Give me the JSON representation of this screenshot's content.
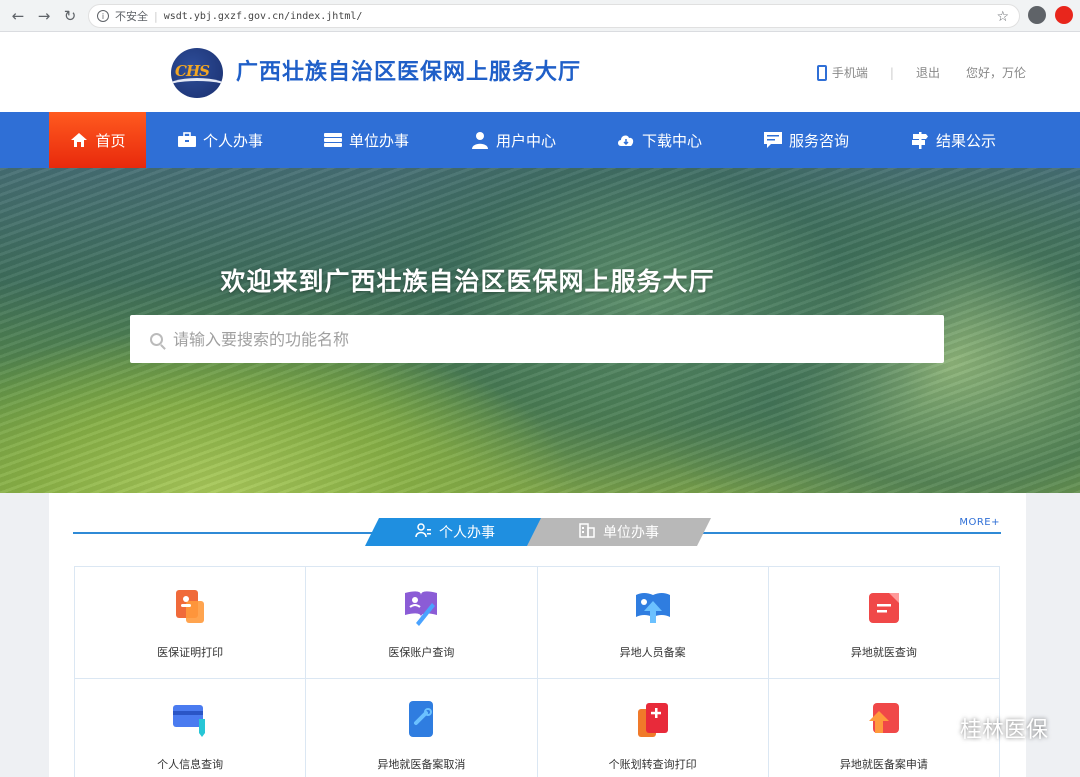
{
  "browser": {
    "security_label": "不安全",
    "url": "wsdt.ybj.gxzf.gov.cn/index.jhtml/"
  },
  "header": {
    "logo_text": "CHS",
    "title": "广西壮族自治区医保网上服务大厅",
    "mobile_label": "手机端",
    "divider": "|",
    "logout_label": "退出",
    "greeting": "您好，万伦"
  },
  "nav": {
    "items": [
      {
        "label": "首页",
        "icon": "home-icon"
      },
      {
        "label": "个人办事",
        "icon": "briefcase-icon"
      },
      {
        "label": "单位办事",
        "icon": "server-icon"
      },
      {
        "label": "用户中心",
        "icon": "user-icon"
      },
      {
        "label": "下载中心",
        "icon": "cloud-download-icon"
      },
      {
        "label": "服务咨询",
        "icon": "chat-icon"
      },
      {
        "label": "结果公示",
        "icon": "signpost-icon"
      }
    ],
    "active_index": 0
  },
  "banner": {
    "title": "欢迎来到广西壮族自治区医保网上服务大厅",
    "search_placeholder": "请输入要搜索的功能名称"
  },
  "services": {
    "tabs": [
      {
        "label": "个人办事",
        "active": true
      },
      {
        "label": "单位办事",
        "active": false
      }
    ],
    "more_label": "MORE+",
    "items": [
      {
        "label": "医保证明打印",
        "icon": "certificate-print-icon"
      },
      {
        "label": "医保账户查询",
        "icon": "account-book-icon"
      },
      {
        "label": "异地人员备案",
        "icon": "relocation-register-icon"
      },
      {
        "label": "异地就医查询",
        "icon": "medical-query-icon"
      },
      {
        "label": "个人信息查询",
        "icon": "card-info-icon"
      },
      {
        "label": "异地就医备案取消",
        "icon": "cancel-register-icon"
      },
      {
        "label": "个账划转查询打印",
        "icon": "transfer-print-icon"
      },
      {
        "label": "异地就医备案申请",
        "icon": "apply-register-icon"
      }
    ]
  },
  "watermark": {
    "text": "桂林医保"
  },
  "colors": {
    "primary": "#2f6fd6",
    "active_nav": "#e8290c",
    "title_blue": "#1f5fc8",
    "tab_active": "#1f8fe0",
    "tab_inactive": "#b8b8b8"
  }
}
